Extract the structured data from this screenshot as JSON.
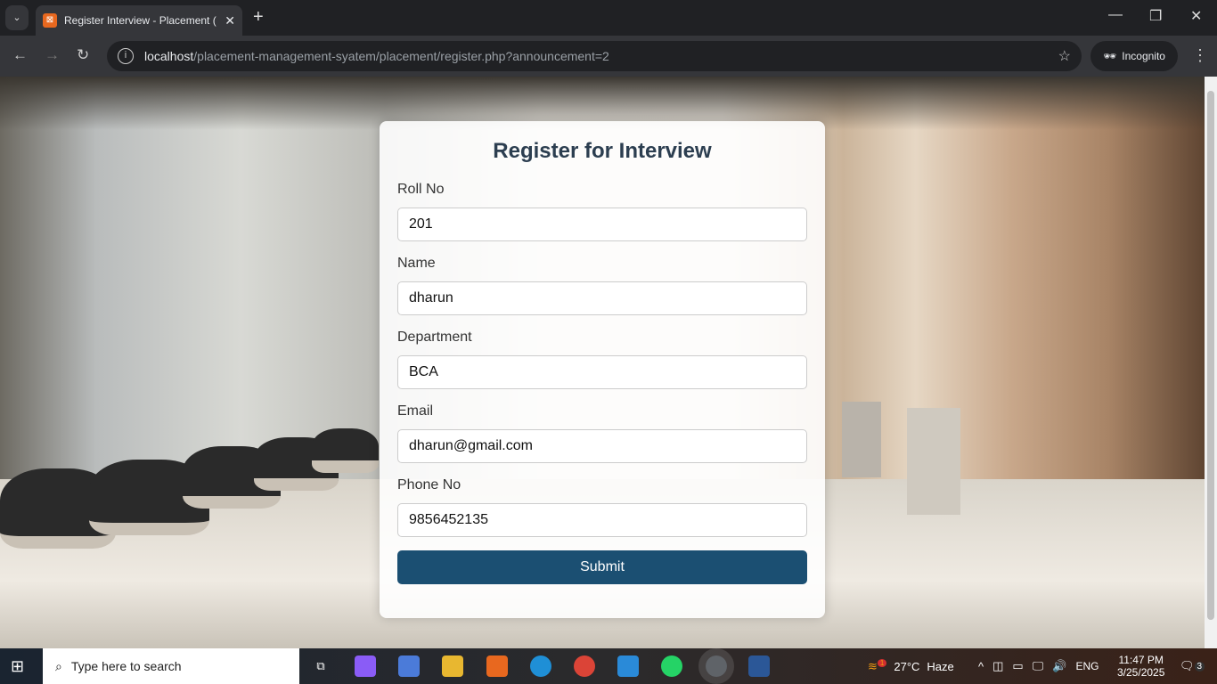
{
  "browser": {
    "tab_title": "Register Interview - Placement (",
    "url_host": "localhost",
    "url_path": "/placement-management-syatem/placement/register.php?announcement=2",
    "incognito_label": "Incognito"
  },
  "form": {
    "title": "Register for Interview",
    "fields": [
      {
        "label": "Roll No",
        "value": "201"
      },
      {
        "label": "Name",
        "value": "dharun"
      },
      {
        "label": "Department",
        "value": "BCA"
      },
      {
        "label": "Email",
        "value": "dharun@gmail.com"
      },
      {
        "label": "Phone No",
        "value": "9856452135"
      }
    ],
    "submit_label": "Submit",
    "submit_color": "#1b4f72"
  },
  "taskbar": {
    "search_placeholder": "Type here to search",
    "weather_temp": "27°C",
    "weather_text": "Haze",
    "weather_badge": "1",
    "language": "ENG",
    "time": "11:47 PM",
    "date": "3/25/2025",
    "notification_count": "3"
  }
}
